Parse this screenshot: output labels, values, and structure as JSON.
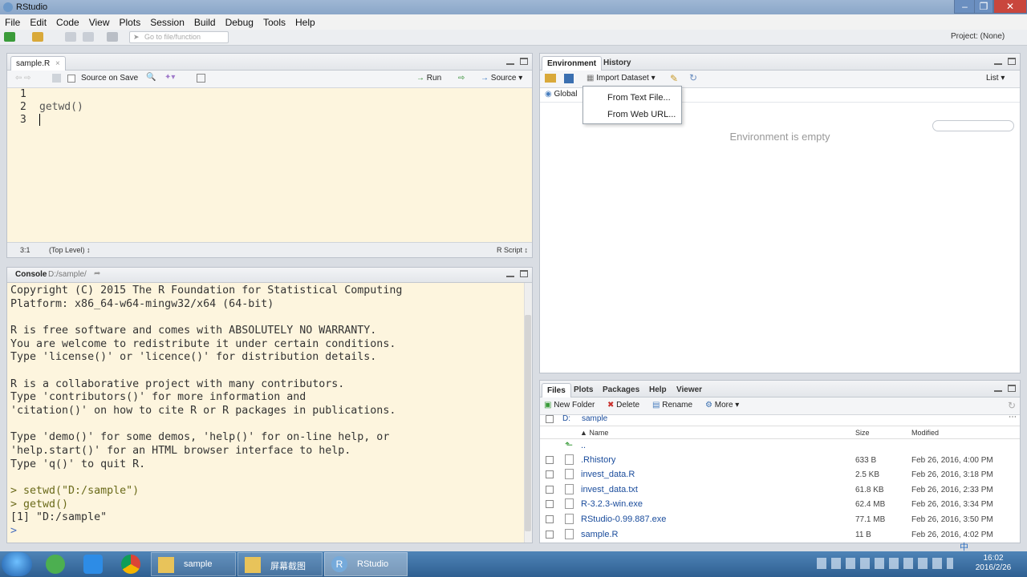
{
  "window": {
    "title": "RStudio"
  },
  "menu": [
    "File",
    "Edit",
    "Code",
    "View",
    "Plots",
    "Session",
    "Build",
    "Debug",
    "Tools",
    "Help"
  ],
  "toolbar": {
    "goto_placeholder": "Go to file/function",
    "project": "Project: (None)"
  },
  "editor": {
    "tab": "sample.R",
    "source_on_save": "Source on Save",
    "run": "Run",
    "source": "Source",
    "lines": [
      "1",
      "2",
      "3"
    ],
    "code": [
      "",
      "getwd()",
      ""
    ],
    "status_pos": "3:1",
    "status_scope": "(Top Level) ↕",
    "status_type": "R Script ↕"
  },
  "console": {
    "tab": "Console",
    "path": "D:/sample/",
    "lines": [
      "Copyright (C) 2015 The R Foundation for Statistical Computing",
      "Platform: x86_64-w64-mingw32/x64 (64-bit)",
      "",
      "R is free software and comes with ABSOLUTELY NO WARRANTY.",
      "You are welcome to redistribute it under certain conditions.",
      "Type 'license()' or 'licence()' for distribution details.",
      "",
      "R is a collaborative project with many contributors.",
      "Type 'contributors()' for more information and",
      "'citation()' on how to cite R or R packages in publications.",
      "",
      "Type 'demo()' for some demos, 'help()' for on-line help, or",
      "'help.start()' for an HTML browser interface to help.",
      "Type 'q()' to quit R.",
      "",
      "> setwd(\"D:/sample\")",
      "> getwd()",
      "[1] \"D:/sample\"",
      "> "
    ]
  },
  "environment": {
    "tabs": [
      "Environment",
      "History"
    ],
    "import": "Import Dataset ▾",
    "list": "List ▾",
    "global": "Global",
    "empty": "Environment is empty",
    "dropdown": [
      "From Text File...",
      "From Web URL..."
    ]
  },
  "files": {
    "tabs": [
      "Files",
      "Plots",
      "Packages",
      "Help",
      "Viewer"
    ],
    "new_folder": "New Folder",
    "delete": "Delete",
    "rename": "Rename",
    "more": "More ▾",
    "breadcrumb": [
      "D:",
      "sample"
    ],
    "headers": {
      "name": "▲ Name",
      "size": "Size",
      "modified": "Modified"
    },
    "up": "..",
    "rows": [
      {
        "name": ".Rhistory",
        "size": "633 B",
        "modified": "Feb 26, 2016, 4:00 PM"
      },
      {
        "name": "invest_data.R",
        "size": "2.5 KB",
        "modified": "Feb 26, 2016, 3:18 PM"
      },
      {
        "name": "invest_data.txt",
        "size": "61.8 KB",
        "modified": "Feb 26, 2016, 2:33 PM"
      },
      {
        "name": "R-3.2.3-win.exe",
        "size": "62.4 MB",
        "modified": "Feb 26, 2016, 3:34 PM"
      },
      {
        "name": "RStudio-0.99.887.exe",
        "size": "77.1 MB",
        "modified": "Feb 26, 2016, 3:50 PM"
      },
      {
        "name": "sample.R",
        "size": "11 B",
        "modified": "Feb 26, 2016, 4:02 PM"
      }
    ]
  },
  "taskbar": {
    "items": [
      "sample",
      "屏幕截图",
      "RStudio"
    ],
    "tray_ime": "中",
    "time": "16:02",
    "date": "2016/2/26"
  }
}
